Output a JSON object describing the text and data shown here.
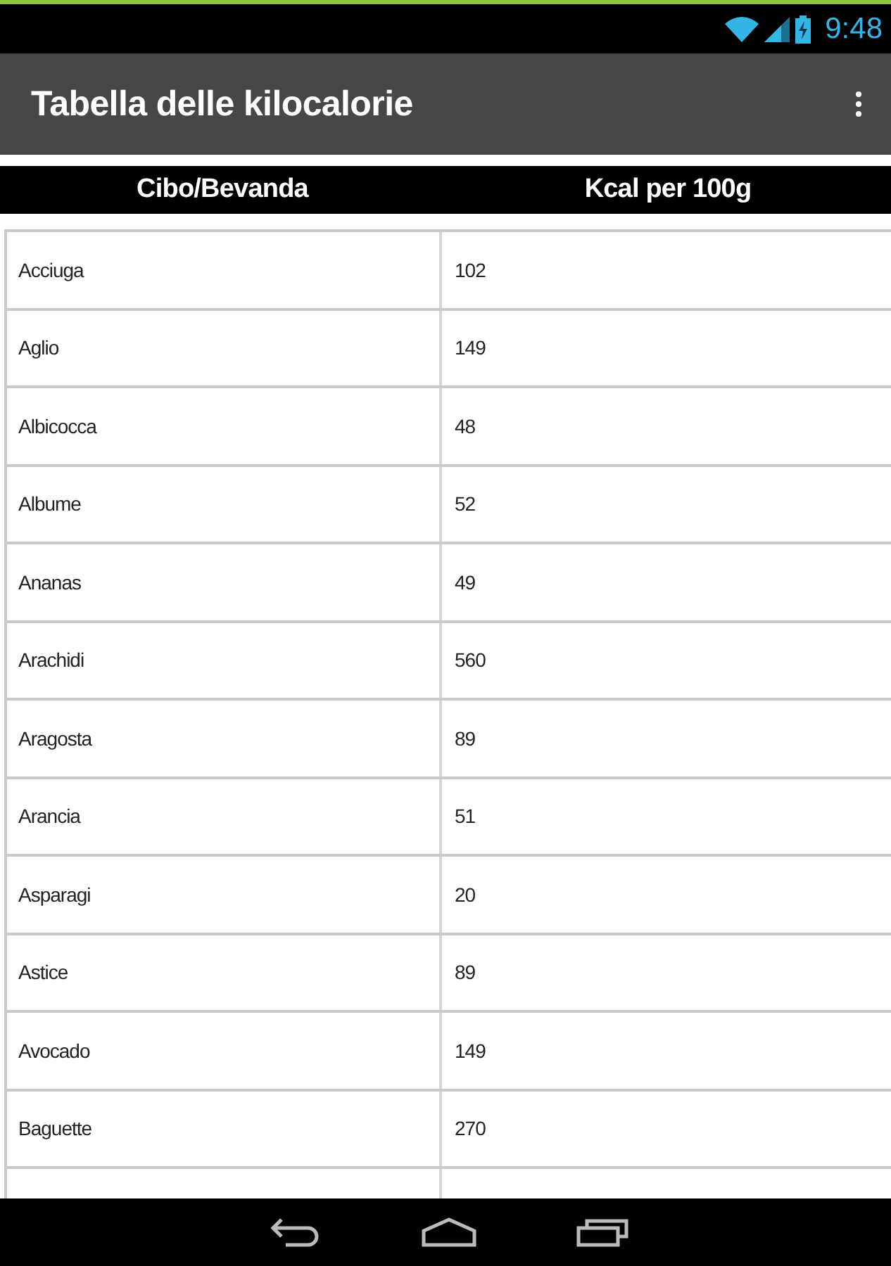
{
  "status_bar": {
    "time": "9:48"
  },
  "action_bar": {
    "title": "Tabella delle kilocalorie"
  },
  "table": {
    "columns": [
      "Cibo/Bevanda",
      "Kcal per 100g"
    ],
    "rows": [
      [
        "Acciuga",
        "102"
      ],
      [
        "Aglio",
        "149"
      ],
      [
        "Albicocca",
        "48"
      ],
      [
        "Albume",
        "52"
      ],
      [
        "Ananas",
        "49"
      ],
      [
        "Arachidi",
        "560"
      ],
      [
        "Aragosta",
        "89"
      ],
      [
        "Arancia",
        "51"
      ],
      [
        "Asparagi",
        "20"
      ],
      [
        "Astice",
        "89"
      ],
      [
        "Avocado",
        "149"
      ],
      [
        "Baguette",
        "270"
      ]
    ]
  }
}
